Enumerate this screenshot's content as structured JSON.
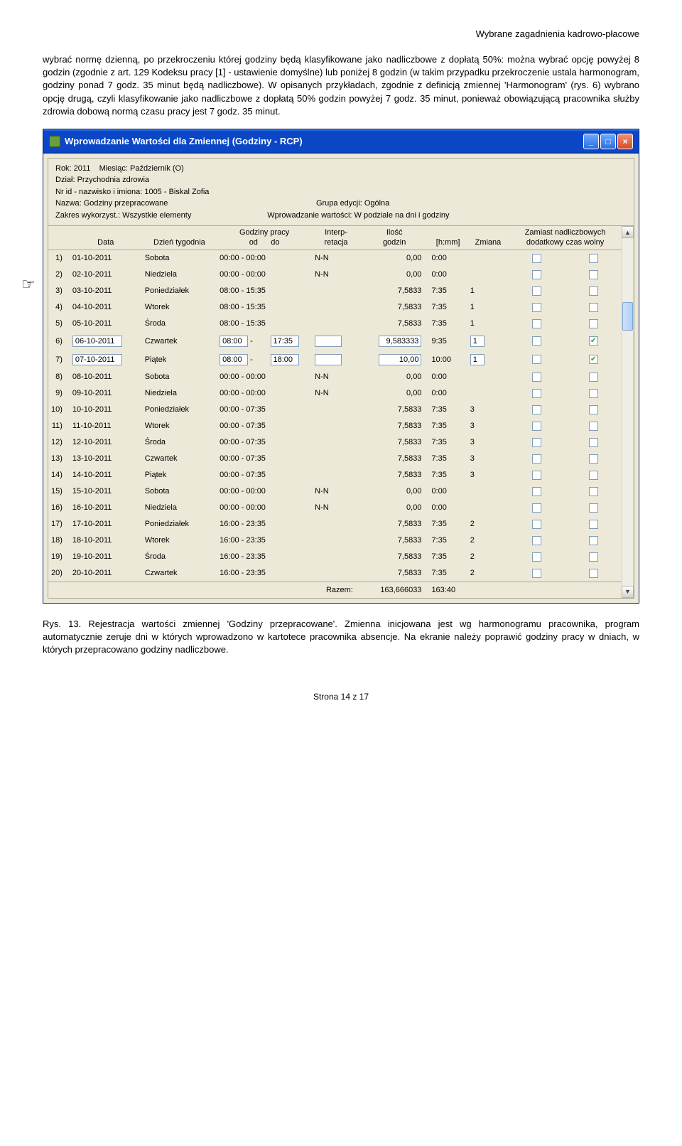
{
  "page_header": "Wybrane zagadnienia kadrowo-płacowe",
  "paragraph1": "wybrać normę dzienną, po przekroczeniu której godziny będą klasyfikowane jako nadliczbowe z dopłatą 50%: można wybrać opcję powyżej 8 godzin (zgodnie z art. 129 Kodeksu pracy [1] - ustawienie domyślne) lub poniżej 8 godzin (w takim przypadku przekroczenie ustala harmonogram, godziny ponad 7 godz. 35 minut będą nadliczbowe). W opisanych przykładach, zgodnie z definicją zmiennej 'Harmonogram' (rys. 6) wybrano opcję drugą, czyli klasyfikowanie jako nadliczbowe z dopłatą 50% godzin powyżej 7 godz. 35 minut, ponieważ obowiązującą pracownika służby zdrowia dobową normą czasu pracy jest 7 godz. 35 minut.",
  "window_title": "Wprowadzanie Wartości dla Zmiennej (Godziny - RCP)",
  "info": {
    "rok_lbl": "Rok: ",
    "rok": "2011",
    "miesiac_lbl": "Miesiąc: ",
    "miesiac": "Październik (O)",
    "dzial_lbl": "Dział: ",
    "dzial": "Przychodnia zdrowia",
    "nrid_lbl": "Nr id - nazwisko i imiona: ",
    "nrid": "1005 - Biskal Zofia",
    "nazwa_lbl": "Nazwa: ",
    "nazwa": "Godziny przepracowane",
    "grupa_lbl": "Grupa edycji: ",
    "grupa": "Ogólna",
    "zakres_lbl": "Zakres wykorzyst.: ",
    "zakres": "Wszystkie elementy",
    "wprow_lbl": "Wprowadzanie wartości: ",
    "wprow": "W podziale na dni i godziny"
  },
  "headers": {
    "data": "Data",
    "dzien": "Dzień tygodnia",
    "godz_od": "Godziny pracy",
    "od": "od",
    "do": "do",
    "interp": "Interp-\nretacja",
    "ilosc": "Ilość\ngodzin",
    "hmm": "[h:mm]",
    "zmiana": "Zmiana",
    "zamiast": "Zamiast nadliczbowych\ndodatkowy czas wolny"
  },
  "rows": [
    {
      "n": "1)",
      "date": "01-10-2011",
      "day": "Sobota",
      "od": "00:00",
      "do": "00:00",
      "int": "N-N",
      "g": "0,00",
      "hm": "0:00",
      "zm": "",
      "c1": false,
      "c2": false,
      "edit": false
    },
    {
      "n": "2)",
      "date": "02-10-2011",
      "day": "Niedziela",
      "od": "00:00",
      "do": "00:00",
      "int": "N-N",
      "g": "0,00",
      "hm": "0:00",
      "zm": "",
      "c1": false,
      "c2": false,
      "edit": false
    },
    {
      "n": "3)",
      "date": "03-10-2011",
      "day": "Poniedziałek",
      "od": "08:00",
      "do": "15:35",
      "int": "",
      "g": "7,5833",
      "hm": "7:35",
      "zm": "1",
      "c1": false,
      "c2": false,
      "edit": false
    },
    {
      "n": "4)",
      "date": "04-10-2011",
      "day": "Wtorek",
      "od": "08:00",
      "do": "15:35",
      "int": "",
      "g": "7,5833",
      "hm": "7:35",
      "zm": "1",
      "c1": false,
      "c2": false,
      "edit": false
    },
    {
      "n": "5)",
      "date": "05-10-2011",
      "day": "Środa",
      "od": "08:00",
      "do": "15:35",
      "int": "",
      "g": "7,5833",
      "hm": "7:35",
      "zm": "1",
      "c1": false,
      "c2": false,
      "edit": false
    },
    {
      "n": "6)",
      "date": "06-10-2011",
      "day": "Czwartek",
      "od": "08:00",
      "do": "17:35",
      "int": "",
      "g": "9,583333",
      "hm": "9:35",
      "zm": "1",
      "c1": false,
      "c2": true,
      "edit": true
    },
    {
      "n": "7)",
      "date": "07-10-2011",
      "day": "Piątek",
      "od": "08:00",
      "do": "18:00",
      "int": "",
      "g": "10,00",
      "hm": "10:00",
      "zm": "1",
      "c1": false,
      "c2": true,
      "edit": true
    },
    {
      "n": "8)",
      "date": "08-10-2011",
      "day": "Sobota",
      "od": "00:00",
      "do": "00:00",
      "int": "N-N",
      "g": "0,00",
      "hm": "0:00",
      "zm": "",
      "c1": false,
      "c2": false,
      "edit": false
    },
    {
      "n": "9)",
      "date": "09-10-2011",
      "day": "Niedziela",
      "od": "00:00",
      "do": "00:00",
      "int": "N-N",
      "g": "0,00",
      "hm": "0:00",
      "zm": "",
      "c1": false,
      "c2": false,
      "edit": false
    },
    {
      "n": "10)",
      "date": "10-10-2011",
      "day": "Poniedziałek",
      "od": "00:00",
      "do": "07:35",
      "int": "",
      "g": "7,5833",
      "hm": "7:35",
      "zm": "3",
      "c1": false,
      "c2": false,
      "edit": false
    },
    {
      "n": "11)",
      "date": "11-10-2011",
      "day": "Wtorek",
      "od": "00:00",
      "do": "07:35",
      "int": "",
      "g": "7,5833",
      "hm": "7:35",
      "zm": "3",
      "c1": false,
      "c2": false,
      "edit": false
    },
    {
      "n": "12)",
      "date": "12-10-2011",
      "day": "Środa",
      "od": "00:00",
      "do": "07:35",
      "int": "",
      "g": "7,5833",
      "hm": "7:35",
      "zm": "3",
      "c1": false,
      "c2": false,
      "edit": false
    },
    {
      "n": "13)",
      "date": "13-10-2011",
      "day": "Czwartek",
      "od": "00:00",
      "do": "07:35",
      "int": "",
      "g": "7,5833",
      "hm": "7:35",
      "zm": "3",
      "c1": false,
      "c2": false,
      "edit": false
    },
    {
      "n": "14)",
      "date": "14-10-2011",
      "day": "Piątek",
      "od": "00:00",
      "do": "07:35",
      "int": "",
      "g": "7,5833",
      "hm": "7:35",
      "zm": "3",
      "c1": false,
      "c2": false,
      "edit": false
    },
    {
      "n": "15)",
      "date": "15-10-2011",
      "day": "Sobota",
      "od": "00:00",
      "do": "00:00",
      "int": "N-N",
      "g": "0,00",
      "hm": "0:00",
      "zm": "",
      "c1": false,
      "c2": false,
      "edit": false
    },
    {
      "n": "16)",
      "date": "16-10-2011",
      "day": "Niedziela",
      "od": "00:00",
      "do": "00:00",
      "int": "N-N",
      "g": "0,00",
      "hm": "0:00",
      "zm": "",
      "c1": false,
      "c2": false,
      "edit": false
    },
    {
      "n": "17)",
      "date": "17-10-2011",
      "day": "Poniedziałek",
      "od": "16:00",
      "do": "23:35",
      "int": "",
      "g": "7,5833",
      "hm": "7:35",
      "zm": "2",
      "c1": false,
      "c2": false,
      "edit": false
    },
    {
      "n": "18)",
      "date": "18-10-2011",
      "day": "Wtorek",
      "od": "16:00",
      "do": "23:35",
      "int": "",
      "g": "7,5833",
      "hm": "7:35",
      "zm": "2",
      "c1": false,
      "c2": false,
      "edit": false
    },
    {
      "n": "19)",
      "date": "19-10-2011",
      "day": "Środa",
      "od": "16:00",
      "do": "23:35",
      "int": "",
      "g": "7,5833",
      "hm": "7:35",
      "zm": "2",
      "c1": false,
      "c2": false,
      "edit": false
    },
    {
      "n": "20)",
      "date": "20-10-2011",
      "day": "Czwartek",
      "od": "16:00",
      "do": "23:35",
      "int": "",
      "g": "7,5833",
      "hm": "7:35",
      "zm": "2",
      "c1": false,
      "c2": false,
      "edit": false
    }
  ],
  "footer": {
    "label": "Razem:",
    "total_g": "163,666033",
    "total_hm": "163:40"
  },
  "caption": "Rys. 13. Rejestracja wartości zmiennej 'Godziny przepracowane'. Zmienna inicjowana jest wg harmonogramu pracownika, program automatycznie zeruje dni w których wprowadzono w kartotece pracownika absencje. Na ekranie należy poprawić godziny pracy w dniach, w których przepracowano godziny nadliczbowe.",
  "page_footer": "Strona 14 z 17"
}
